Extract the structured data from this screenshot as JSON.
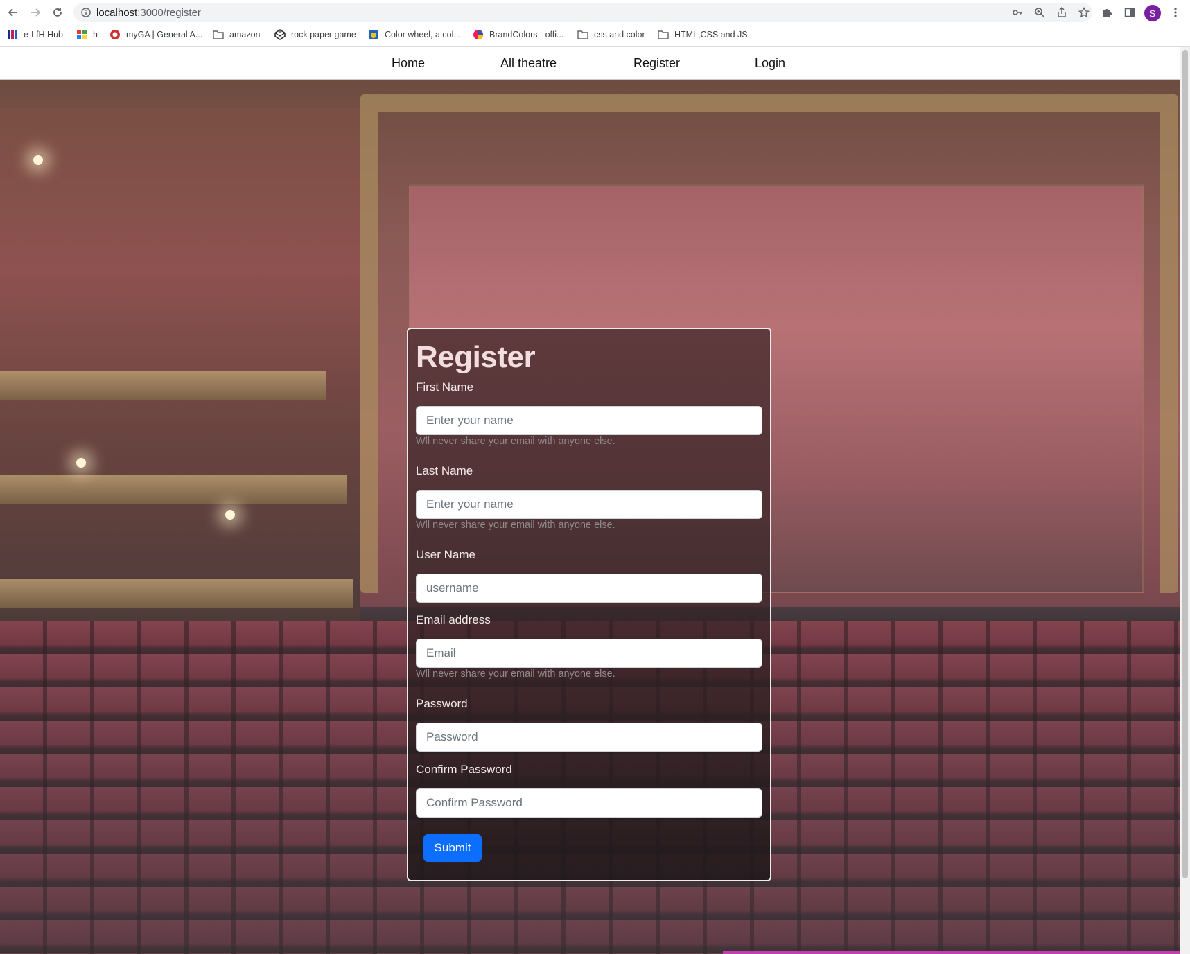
{
  "browser": {
    "url_host": "localhost",
    "url_path": ":3000/register",
    "profile_initial": "S",
    "bookmarks": [
      {
        "label": "e-LfH Hub",
        "icon": "elfh-icon"
      },
      {
        "label": "h",
        "icon": "grid-icon"
      },
      {
        "label": "myGA | General A...",
        "icon": "ga-icon"
      },
      {
        "label": "amazon",
        "icon": "folder-icon"
      },
      {
        "label": "rock paper game",
        "icon": "codepen-icon"
      },
      {
        "label": "Color wheel, a col...",
        "icon": "color-wheel-icon"
      },
      {
        "label": "BrandColors - offi...",
        "icon": "brandcolors-icon"
      },
      {
        "label": "css and color",
        "icon": "folder-icon"
      },
      {
        "label": "HTML,CSS and JS",
        "icon": "folder-icon"
      }
    ]
  },
  "nav": {
    "items": [
      {
        "label": "Home"
      },
      {
        "label": "All theatre"
      },
      {
        "label": "Register"
      },
      {
        "label": "Login"
      }
    ]
  },
  "form": {
    "title": "Register",
    "fields": [
      {
        "label": "First Name",
        "placeholder": "Enter your name",
        "value": "",
        "help": "Wll never share your email with anyone else."
      },
      {
        "label": "Last Name",
        "placeholder": "Enter your name",
        "value": "",
        "help": "Wll never share your email with anyone else."
      },
      {
        "label": "User Name",
        "placeholder": "username",
        "value": ""
      },
      {
        "label": "Email address",
        "placeholder": "Email",
        "value": "",
        "help": "Wll never share your email with anyone else."
      },
      {
        "label": "Password",
        "placeholder": "Password",
        "value": ""
      },
      {
        "label": "Confirm Password",
        "placeholder": "Confirm Password",
        "value": ""
      }
    ],
    "submit_label": "Submit"
  },
  "colors": {
    "submit_bg": "#0d6efd",
    "avatar_bg": "#7b1fa2"
  }
}
